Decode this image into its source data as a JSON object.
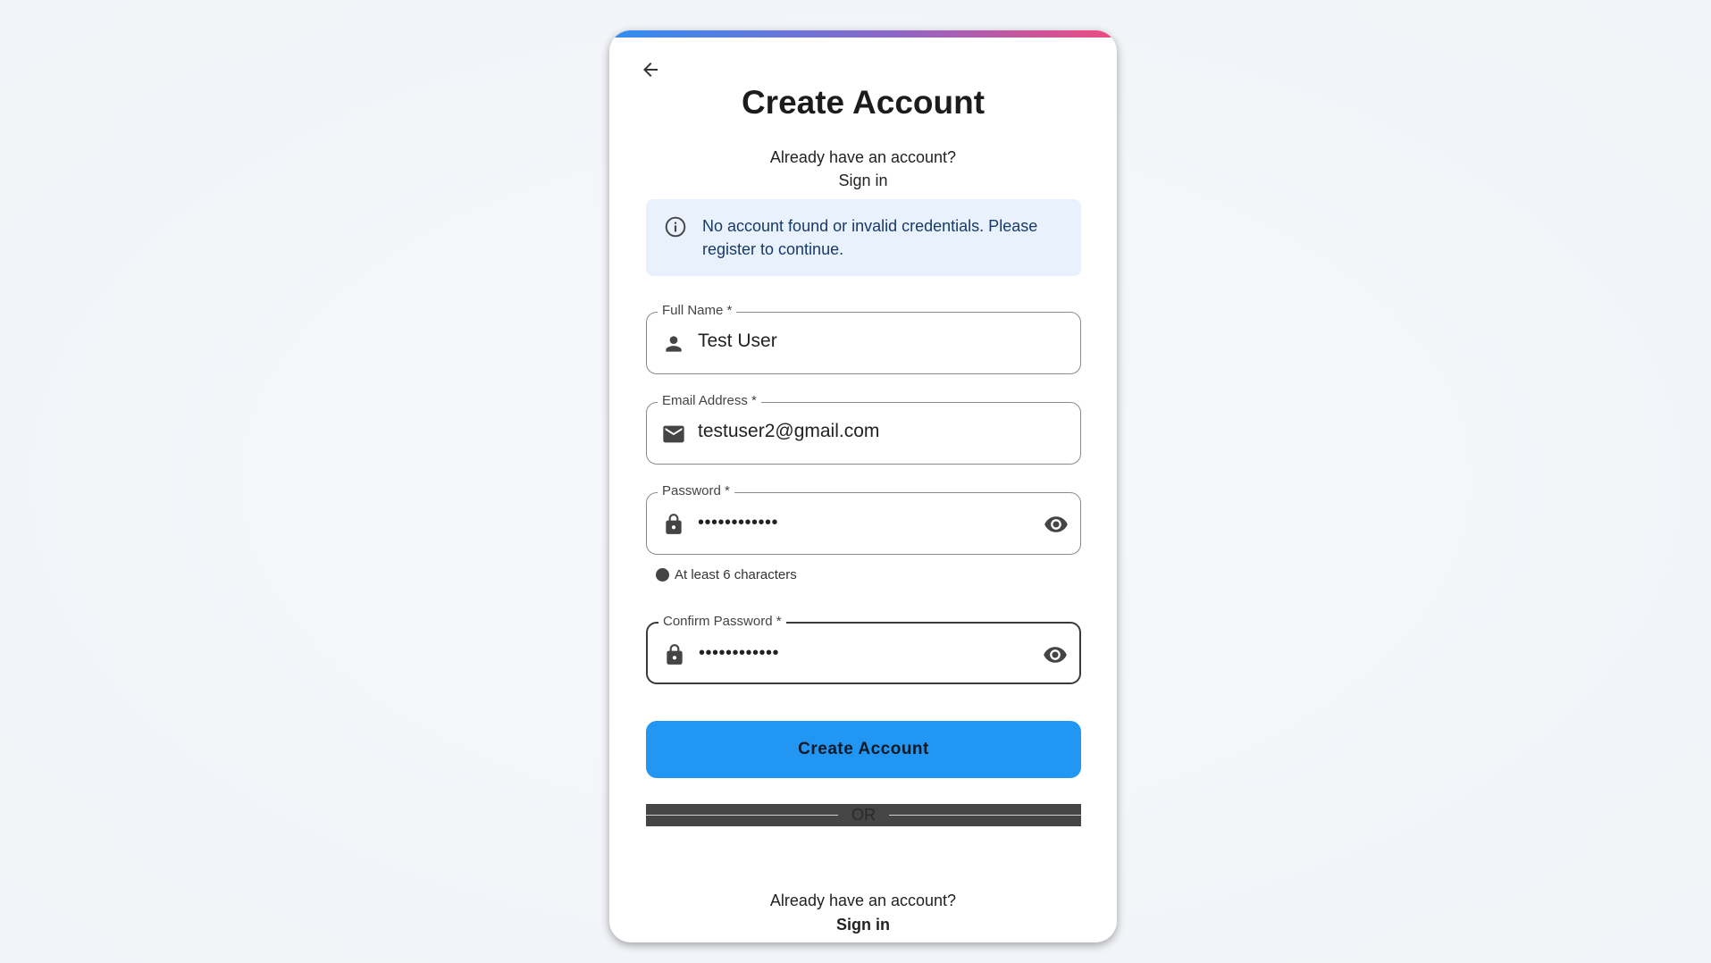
{
  "header": {
    "title": "Create Account",
    "prompt": "Already have an account?",
    "signin_link": "Sign in"
  },
  "alert": {
    "message": "No account found or invalid credentials. Please register to continue.",
    "icon": "info-icon"
  },
  "form": {
    "full_name": {
      "label": "Full Name *",
      "value": "Test User",
      "icon": "person-icon"
    },
    "email": {
      "label": "Email Address *",
      "value": "testuser2@gmail.com",
      "icon": "mail-icon"
    },
    "password": {
      "label": "Password *",
      "value": "••••••••••••",
      "icon": "lock-icon",
      "toggle_icon": "eye-icon"
    },
    "password_hint": "At least 6 characters",
    "confirm_password": {
      "label": "Confirm Password *",
      "value": "••••••••••••",
      "icon": "lock-icon",
      "toggle_icon": "eye-icon"
    },
    "submit_label": "Create Account"
  },
  "divider": {
    "label": "OR"
  },
  "footer": {
    "prompt": "Already have an account?",
    "signin_link": "Sign in"
  },
  "colors": {
    "primary": "#2196f3",
    "gradient_start": "#2f8ff0",
    "gradient_end": "#ee4a7f",
    "alert_bg": "#e9f1fc"
  }
}
